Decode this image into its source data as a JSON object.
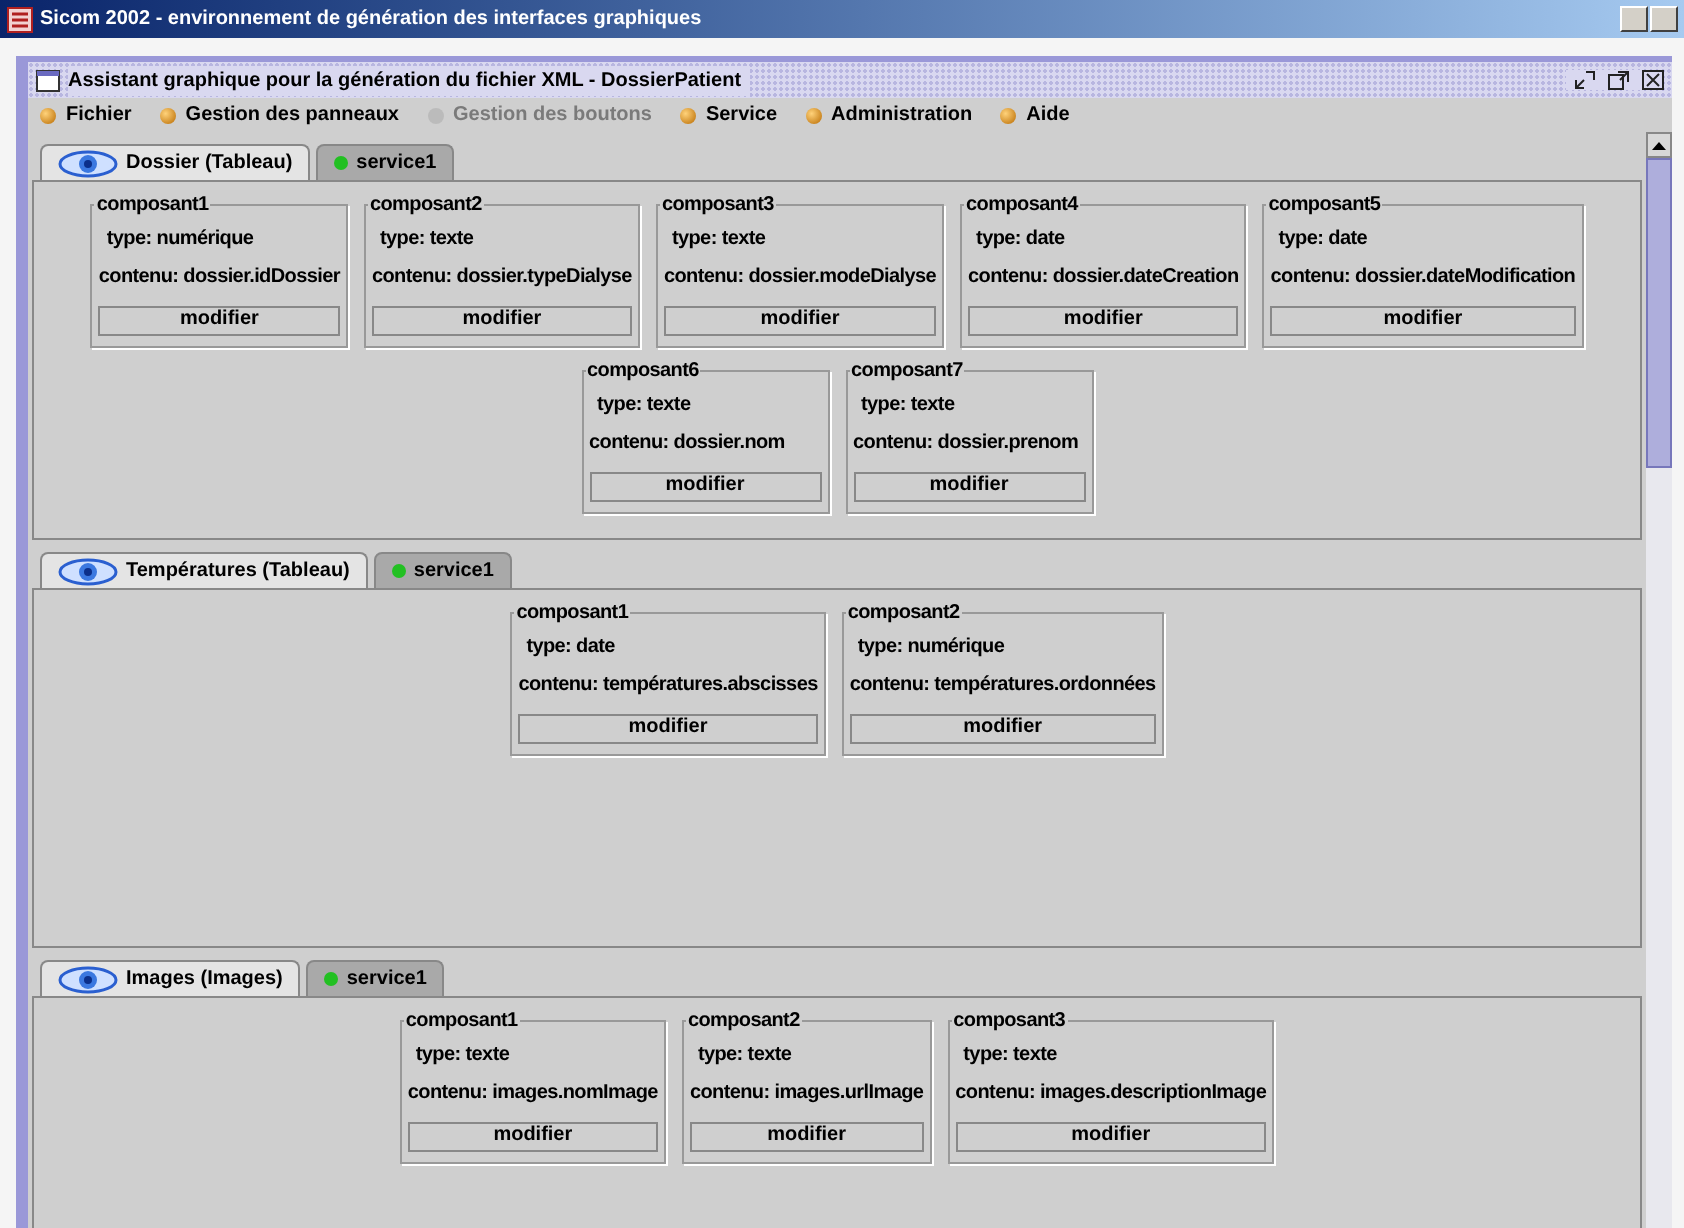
{
  "window": {
    "title": "Sicom 2002 - environnement de génération des interfaces graphiques"
  },
  "frame": {
    "title": "Assistant graphique pour la génération du fichier XML - DossierPatient"
  },
  "menu": [
    {
      "label": "Fichier",
      "disabled": false
    },
    {
      "label": "Gestion des panneaux",
      "disabled": false
    },
    {
      "label": "Gestion des boutons",
      "disabled": true
    },
    {
      "label": "Service",
      "disabled": false
    },
    {
      "label": "Administration",
      "disabled": false
    },
    {
      "label": "Aide",
      "disabled": false
    }
  ],
  "panels": [
    {
      "tabs": [
        {
          "kind": "view",
          "label": "Dossier (Tableau)",
          "selected": true
        },
        {
          "kind": "service",
          "label": "service1",
          "selected": false,
          "color": "#22c022"
        }
      ],
      "components": [
        {
          "title": "composant1",
          "type": "type: numérique",
          "content": "contenu: dossier.idDossier",
          "button": "modifier"
        },
        {
          "title": "composant2",
          "type": "type: texte",
          "content": "contenu: dossier.typeDialyse",
          "button": "modifier"
        },
        {
          "title": "composant3",
          "type": "type: texte",
          "content": "contenu: dossier.modeDialyse",
          "button": "modifier"
        },
        {
          "title": "composant4",
          "type": "type: date",
          "content": "contenu: dossier.dateCreation",
          "button": "modifier"
        },
        {
          "title": "composant5",
          "type": "type: date",
          "content": "contenu: dossier.dateModification",
          "button": "modifier"
        },
        {
          "title": "composant6",
          "type": "type: texte",
          "content": "contenu: dossier.nom",
          "button": "modifier"
        },
        {
          "title": "composant7",
          "type": "type: texte",
          "content": "contenu: dossier.prenom",
          "button": "modifier"
        }
      ]
    },
    {
      "tabs": [
        {
          "kind": "view",
          "label": "Températures (Tableau)",
          "selected": true
        },
        {
          "kind": "service",
          "label": "service1",
          "selected": false,
          "color": "#22c022"
        }
      ],
      "components": [
        {
          "title": "composant1",
          "type": "type: date",
          "content": "contenu: températures.abscisses",
          "button": "modifier"
        },
        {
          "title": "composant2",
          "type": "type: numérique",
          "content": "contenu: températures.ordonnées",
          "button": "modifier"
        }
      ]
    },
    {
      "tabs": [
        {
          "kind": "view",
          "label": "Images (Images)",
          "selected": true
        },
        {
          "kind": "service",
          "label": "service1",
          "selected": false,
          "color": "#22c022"
        }
      ],
      "components": [
        {
          "title": "composant1",
          "type": "type: texte",
          "content": "contenu: images.nomImage",
          "button": "modifier"
        },
        {
          "title": "composant2",
          "type": "type: texte",
          "content": "contenu: images.urlImage",
          "button": "modifier"
        },
        {
          "title": "composant3",
          "type": "type: texte",
          "content": "contenu: images.descriptionImage",
          "button": "modifier"
        }
      ]
    }
  ]
}
